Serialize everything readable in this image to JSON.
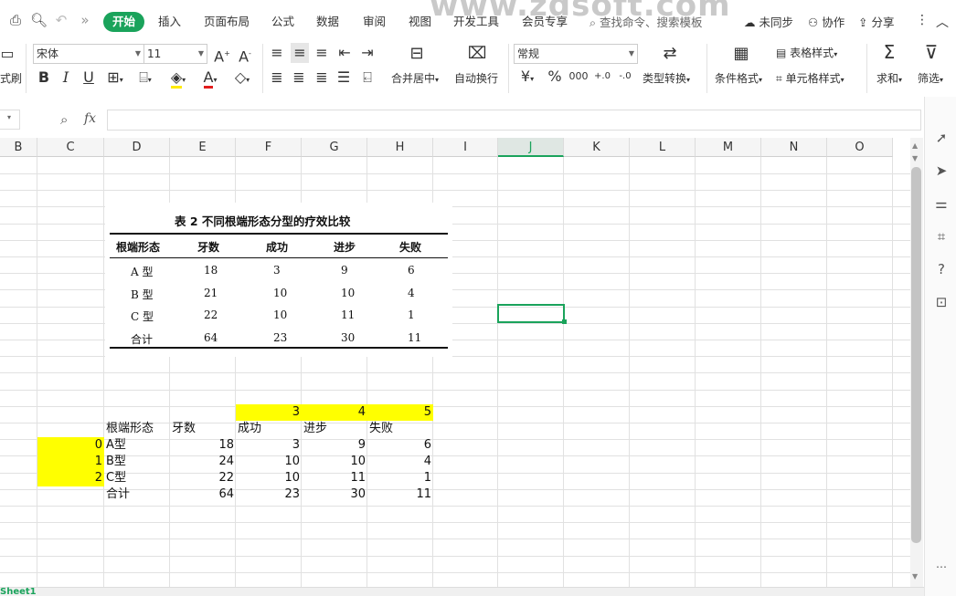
{
  "watermark": "www.zdsoft.com",
  "menu": {
    "tabs": [
      "开始",
      "插入",
      "页面布局",
      "公式",
      "数据",
      "审阅",
      "视图",
      "开发工具",
      "会员专享"
    ],
    "search_placeholder": "查找命令、搜索模板",
    "sync": "未同步",
    "collab": "协作",
    "share": "分享"
  },
  "ribbon": {
    "format_painter": "式刷",
    "font_name": "宋体",
    "font_size": "11",
    "merge_center": "合并居中",
    "auto_wrap": "自动换行",
    "number_format": "常规",
    "type_convert": "类型转换",
    "conditional_format": "条件格式",
    "table_style": "表格样式",
    "cell_style": "单元格样式",
    "sum": "求和",
    "filter": "筛选"
  },
  "formula_bar": {
    "fx": "fx",
    "value": ""
  },
  "columns": [
    "B",
    "C",
    "D",
    "E",
    "F",
    "G",
    "H",
    "I",
    "J",
    "K",
    "L",
    "M",
    "N",
    "O"
  ],
  "selected_column": "J",
  "pasted_table": {
    "title": "表 2   不同根端形态分型的疗效比较",
    "headers": [
      "根端形态",
      "牙数",
      "成功",
      "进步",
      "失败"
    ],
    "rows": [
      [
        "A 型",
        "18",
        "3",
        "9",
        "6"
      ],
      [
        "B 型",
        "21",
        "10",
        "10",
        "4"
      ],
      [
        "C 型",
        "22",
        "10",
        "11",
        "1"
      ],
      [
        "合计",
        "64",
        "23",
        "30",
        "11"
      ]
    ]
  },
  "sheet_cells": {
    "index_row": [
      "3",
      "4",
      "5"
    ],
    "header": [
      "根端形态",
      "牙数",
      "成功",
      "进步",
      "失败"
    ],
    "row_index": [
      "0",
      "1",
      "2"
    ],
    "rows": [
      [
        "A型",
        "18",
        "3",
        "9",
        "6"
      ],
      [
        "B型",
        "24",
        "10",
        "10",
        "4"
      ],
      [
        "C型",
        "22",
        "10",
        "11",
        "1"
      ],
      [
        "合计",
        "64",
        "23",
        "30",
        "11"
      ]
    ]
  },
  "sheet_tab": "Sheet1",
  "colors": {
    "accent": "#1aa35b",
    "highlight": "#ffff00"
  }
}
